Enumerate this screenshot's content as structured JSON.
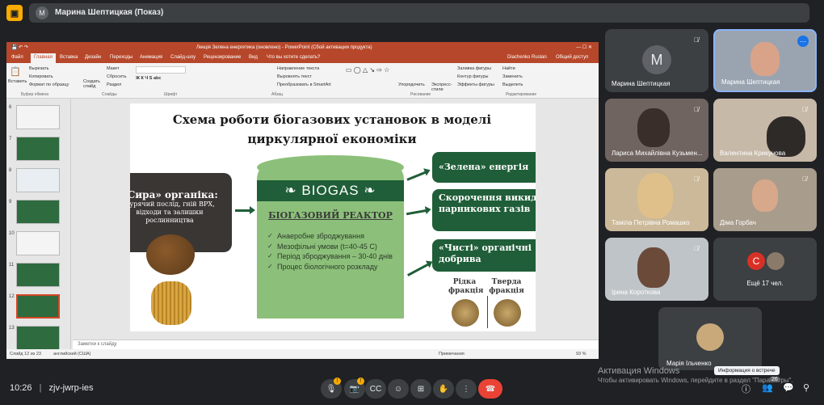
{
  "meet": {
    "presenter_initial": "M",
    "presenting_title": "Марина Шептицкая (Показ)",
    "meeting_code": "10:26   |   zjv-jwrp-ies",
    "time": "10:26",
    "code": "zjv-jwrp-ies",
    "more_participants": "Ещё 17 чел.",
    "participant_count": "26",
    "tooltip": "Информация о встрече",
    "activation_title": "Активация Windows",
    "activation_text": "Чтобы активировать Windows, перейдите в раздел \"Параметры\"."
  },
  "ppt": {
    "window_title": "Лекція Зелена енергетика (оновлено) - PowerPoint (Сбой активации продукта)",
    "user": "Diachenko Ruslan",
    "share": "Общий доступ",
    "tabs": [
      "Файл",
      "Главная",
      "Вставка",
      "Дизайн",
      "Переходы",
      "Анимация",
      "Слайд-шоу",
      "Рецензирование",
      "Вид",
      "Что вы хотите сделать?"
    ],
    "ribbon": {
      "paste": "Вставить",
      "cut": "Вырезать",
      "copy": "Копировать",
      "format_painter": "Формат по образцу",
      "new_slide": "Создать слайд",
      "layout": "Макет",
      "reset": "Сбросить",
      "section": "Раздел",
      "text_direction": "Направление текста",
      "align_text": "Выровнять текст",
      "smartart": "Преобразовать в SmartArt",
      "arrange": "Упорядочить",
      "quick_styles": "Экспресс-стили",
      "shape_fill": "Заливка фигуры",
      "shape_outline": "Контур фигуры",
      "shape_effects": "Эффекты фигуры",
      "find": "Найти",
      "replace": "Заменить",
      "select": "Выделить",
      "groups": [
        "Буфер обмена",
        "Слайды",
        "Шрифт",
        "Абзац",
        "Рисование",
        "Редактирование"
      ]
    },
    "thumbs": [
      {
        "num": "6",
        "color": "#f4f4f4"
      },
      {
        "num": "7",
        "color": "#2e6b3f"
      },
      {
        "num": "8",
        "color": "#e9eef2"
      },
      {
        "num": "9",
        "color": "#2e6b3f"
      },
      {
        "num": "10",
        "color": "#f4f4f4"
      },
      {
        "num": "11",
        "color": "#2e6b3f"
      },
      {
        "num": "12",
        "color": "#2e6b3f"
      },
      {
        "num": "13",
        "color": "#2e6b3f"
      }
    ],
    "notes_placeholder": "Заметки к слайду",
    "status_left": "Слайд 12 из 23",
    "status_lang": "английский (США)",
    "status_notes": "Примечания",
    "zoom": "93 %"
  },
  "slide": {
    "title_line1": "Схема роботи біогазових установок  в моделі",
    "title_line2": "циркулярної економіки",
    "raw_title": "«Сира» органіка:",
    "raw_sub": "Курячий послід, гній ВРХ, відходи та залишки рослинництва",
    "biogas": "BIOGAS",
    "reactor_title": "БІОГАЗОВИЙ РЕАКТОР",
    "reactor_items": [
      "Анаеробне зброджування",
      "Мезофільні умови (t=40-45 C)",
      "Період зброджування – 30-40 днів",
      "Процес біологічного розкладу"
    ],
    "out1": "«Зелена» енергія",
    "out2": "Скорочення викидів парникових газів",
    "out3": "«Чисті» органічні добрива",
    "liquid": "Рідка фракція",
    "solid": "Тверда фракція"
  },
  "participants": [
    {
      "name": "Марина Шептицкая",
      "initial": "M"
    },
    {
      "name": "Марина Шептицкая"
    },
    {
      "name": "Лариса Михайлівна Кузьмен..."
    },
    {
      "name": "Валентина Крикунова"
    },
    {
      "name": "Таміла Петрівна Ромашко"
    },
    {
      "name": "Діма Горбач"
    },
    {
      "name": "Ірина Короткова"
    },
    {
      "name": "Марія Ільченко"
    }
  ],
  "colors": {
    "meet_bg": "#202124",
    "ppt_accent": "#b7472a",
    "slide_green": "#1f5e38",
    "tank_green": "#8cc07a",
    "end_call": "#ea4335"
  }
}
